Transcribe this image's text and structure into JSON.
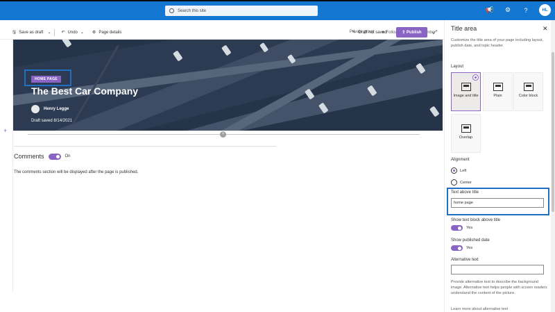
{
  "suite": {
    "search_placeholder": "Search this site",
    "avatar_initials": "HL"
  },
  "meta": {
    "privacy": "Private group",
    "following": "Following",
    "members": "1 member"
  },
  "commands": {
    "save_draft": "Save as draft",
    "undo": "Undo",
    "page_details": "Page details",
    "status": "Draft not saved",
    "publish": "Publish"
  },
  "hero": {
    "tag": "HOME PAGE",
    "title": "The Best Car Company",
    "author": "Henry Legge",
    "draft_saved": "Draft saved 8/14/2021"
  },
  "comments": {
    "heading": "Comments",
    "toggle_label": "On",
    "note": "The comments section will be displayed after the page is published."
  },
  "panel": {
    "title": "Title area",
    "description": "Customize the title area of your page including layout, publish date, and topic header.",
    "layout_label": "Layout",
    "layouts": [
      {
        "label": "Image and title",
        "selected": true
      },
      {
        "label": "Plain",
        "selected": false
      },
      {
        "label": "Color block",
        "selected": false
      },
      {
        "label": "Overlap",
        "selected": false
      }
    ],
    "alignment_label": "Alignment",
    "alignment_left": "Left",
    "alignment_center": "Center",
    "text_above_label": "Text above title",
    "text_above_value": "home page",
    "show_text_block_label": "Show text block above title",
    "show_text_block_value": "Yes",
    "show_date_label": "Show published date",
    "show_date_value": "Yes",
    "alt_text_label": "Alternative text",
    "alt_help": "Provide alternative text to describe the background image. Alternative text helps people with screen readers understand the content of the picture.",
    "learn_more": "Learn more about alternative text"
  },
  "colors": {
    "accent": "#8a64c4",
    "suitebar": "#1376d1",
    "highlight": "#1f6fc4"
  }
}
